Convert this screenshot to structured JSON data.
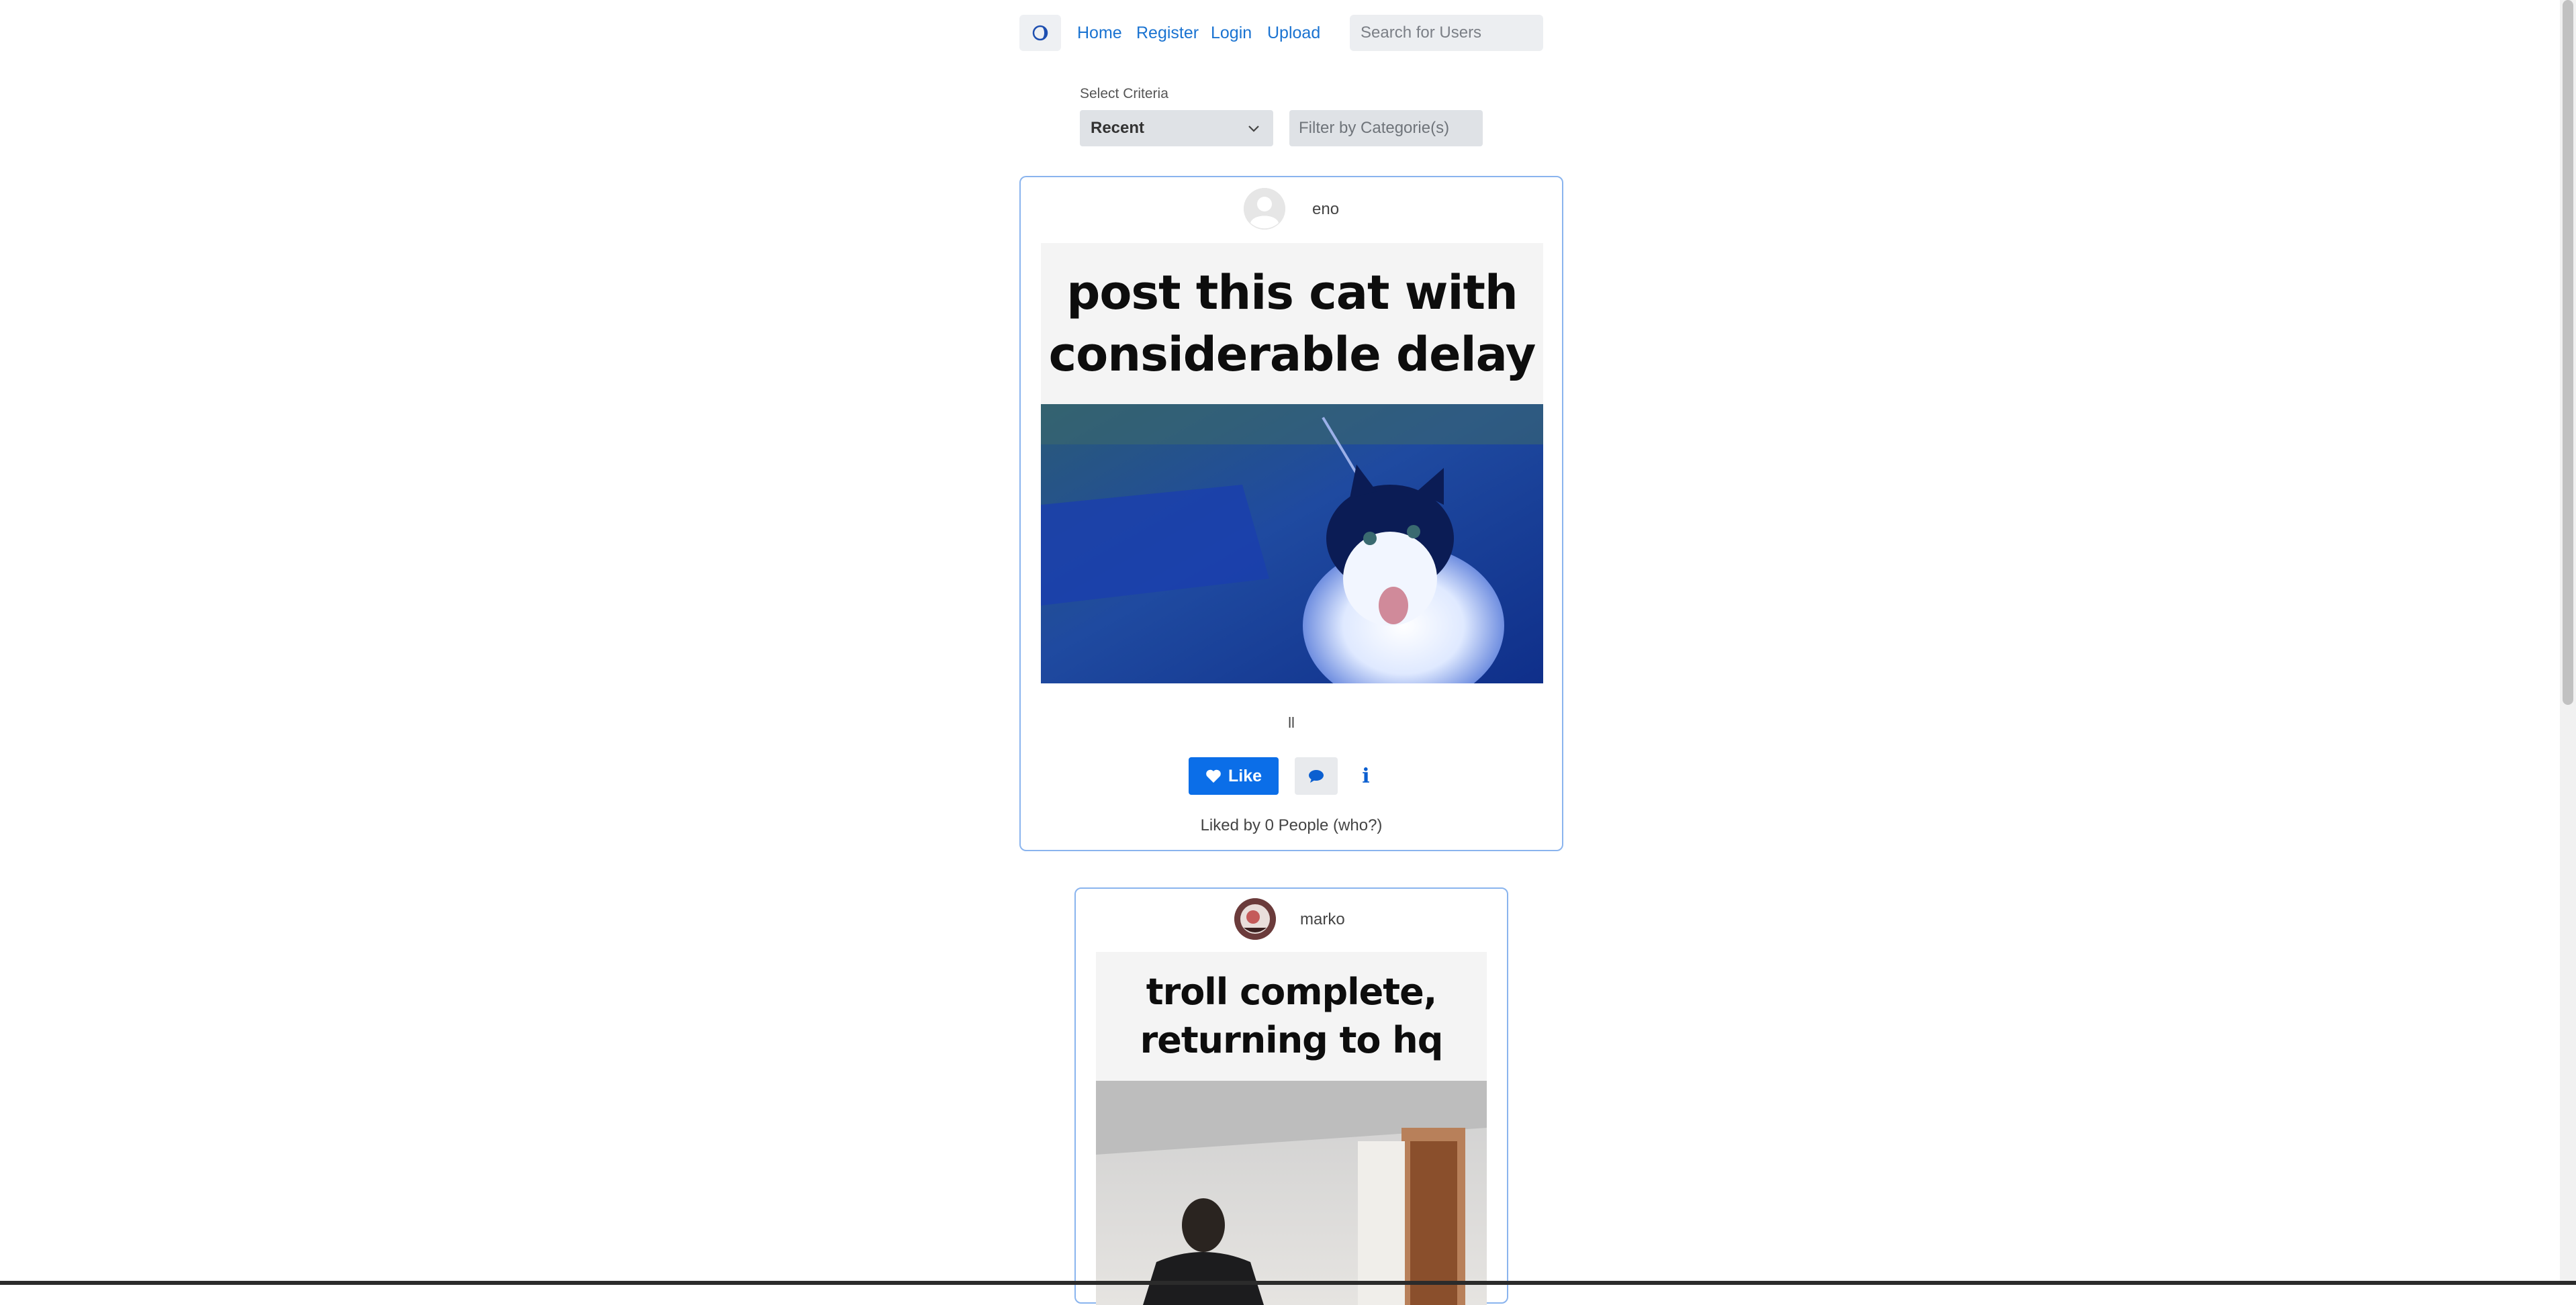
{
  "nav": {
    "logo_icon": "theme-toggle-icon",
    "home": "Home",
    "register": "Register",
    "login": "Login",
    "upload": "Upload",
    "search_placeholder": "Search for Users"
  },
  "criteria": {
    "label": "Select Criteria",
    "selected": "Recent",
    "filter_placeholder": "Filter by Categorie(s)"
  },
  "posts": [
    {
      "username": "eno",
      "meme_caption_line1": "post this cat with",
      "meme_caption_line2": "considerable delay",
      "description": "ll",
      "like_label": "Like",
      "liked_by": "Liked by 0 People (who?)",
      "info_label": "i"
    },
    {
      "username": "marko",
      "meme_caption_line1": "troll complete,",
      "meme_caption_line2": "returning to hq"
    }
  ],
  "colors": {
    "accent": "#0b6ee8",
    "link": "#1a73d1",
    "card_border": "#8ab4ee"
  }
}
